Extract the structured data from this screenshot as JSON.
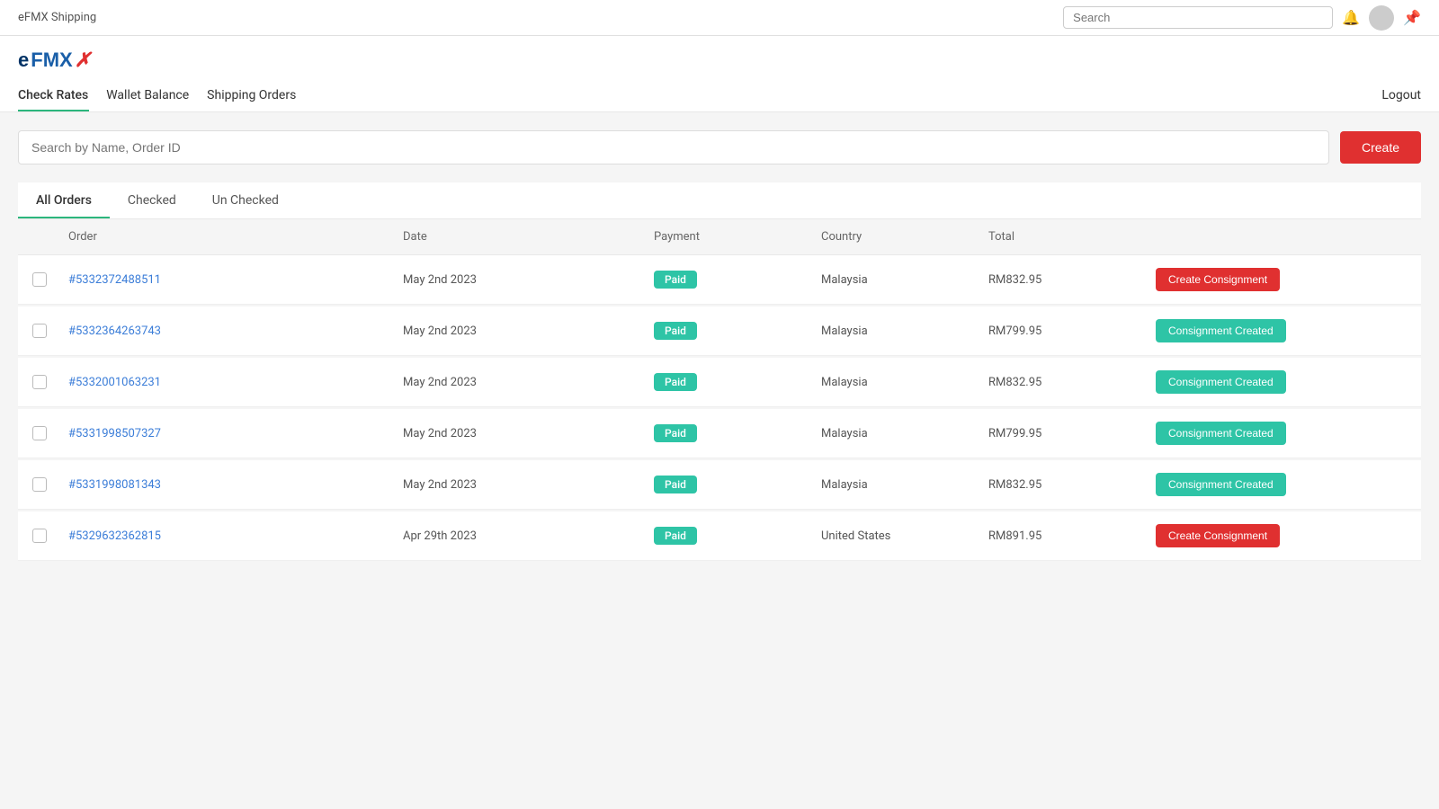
{
  "app": {
    "title": "eFMX Shipping",
    "pin_icon": "📌"
  },
  "topbar": {
    "search_placeholder": "Search",
    "logout_label": "Logout"
  },
  "logo": {
    "text_e": "e",
    "text_fmx": "FMX",
    "symbol": "✓"
  },
  "nav": {
    "items": [
      {
        "label": "Check Rates",
        "active": true
      },
      {
        "label": "Wallet Balance",
        "active": false
      },
      {
        "label": "Shipping Orders",
        "active": false
      }
    ],
    "logout": "Logout"
  },
  "search": {
    "placeholder": "Search by Name, Order ID",
    "create_label": "Create"
  },
  "tabs": [
    {
      "label": "All Orders",
      "active": true
    },
    {
      "label": "Checked",
      "active": false
    },
    {
      "label": "Un Checked",
      "active": false
    }
  ],
  "table": {
    "columns": [
      "",
      "Order",
      "Date",
      "Payment",
      "Country",
      "Total",
      ""
    ],
    "rows": [
      {
        "id": "#5332372488511",
        "date": "May 2nd 2023",
        "payment": "Paid",
        "country": "Malaysia",
        "total": "RM832.95",
        "action": "Create Consignment",
        "action_type": "create"
      },
      {
        "id": "#5332364263743",
        "date": "May 2nd 2023",
        "payment": "Paid",
        "country": "Malaysia",
        "total": "RM799.95",
        "action": "Consignment Created",
        "action_type": "created"
      },
      {
        "id": "#5332001063231",
        "date": "May 2nd 2023",
        "payment": "Paid",
        "country": "Malaysia",
        "total": "RM832.95",
        "action": "Consignment Created",
        "action_type": "created"
      },
      {
        "id": "#5331998507327",
        "date": "May 2nd 2023",
        "payment": "Paid",
        "country": "Malaysia",
        "total": "RM799.95",
        "action": "Consignment Created",
        "action_type": "created"
      },
      {
        "id": "#5331998081343",
        "date": "May 2nd 2023",
        "payment": "Paid",
        "country": "Malaysia",
        "total": "RM832.95",
        "action": "Consignment Created",
        "action_type": "created"
      },
      {
        "id": "#5329632362815",
        "date": "Apr 29th 2023",
        "payment": "Paid",
        "country": "United States",
        "total": "RM891.95",
        "action": "Create Consignment",
        "action_type": "create"
      }
    ]
  }
}
